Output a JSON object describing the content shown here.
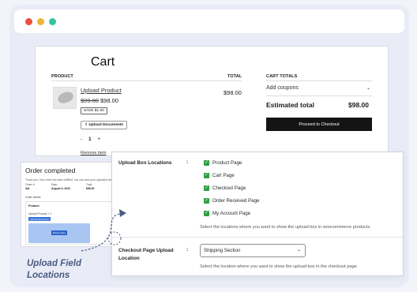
{
  "colors": {
    "background": "#f2f4fa",
    "window": "#e9ecf6",
    "checkbox": "#2f9e44",
    "proceed_button": "#141414",
    "annotation": "#4a5b83",
    "upload_button": "#3b74d9"
  },
  "cart": {
    "title": "Cart",
    "headers": {
      "product": "PRODUCT",
      "total": "TOTAL",
      "cart_totals": "CART TOTALS"
    },
    "item": {
      "name": "Upload Product",
      "old_price": "$99.00",
      "price": "$98.00",
      "badge": "SAVE $1.00",
      "upload_button": "Upload Documents",
      "qty_minus": "-",
      "qty_value": "1",
      "qty_plus": "+",
      "remove": "Remove item",
      "total": "$98.00"
    },
    "coupons": "Add coupons",
    "estimated_label": "Estimated total",
    "estimated_value": "$98.00",
    "proceed_button": "Proceed to Checkout"
  },
  "order": {
    "title": "Order completed",
    "thanks": "Thank you. Your order has been fulfilled. You can view your uploaded documents.",
    "cols": [
      {
        "label": "Order #:",
        "value": "3a1"
      },
      {
        "label": "Date:",
        "value": "August 5, 2023"
      },
      {
        "label": "Total:",
        "value": "$98.00"
      }
    ],
    "details": "Order details",
    "product_header": "Product",
    "product_line": "Upload Product × 1",
    "upload_button": "Upload Documents",
    "drop_button": "Browse Files"
  },
  "settings": {
    "upload_box_label": "Upload Box Locations",
    "colon": ":",
    "locations": [
      "Product Page",
      "Cart Page",
      "Checkout Page",
      "Order Received Page",
      "My Account Page"
    ],
    "locations_desc": "Select the locations where you want to show the upload box in woocommerce products.",
    "checkout_label_1": "Checkout Page Upload",
    "checkout_label_2": "Location",
    "checkout_select": "Shipping Section",
    "checkout_desc": "Select the location where you want to show the upload box in the checkout page."
  },
  "annotation": {
    "line1": "Upload Field",
    "line2": "Locations"
  },
  "icons": {
    "dropdown": "chevron-down-icon",
    "check": "check-icon",
    "upload": "upload-icon"
  }
}
